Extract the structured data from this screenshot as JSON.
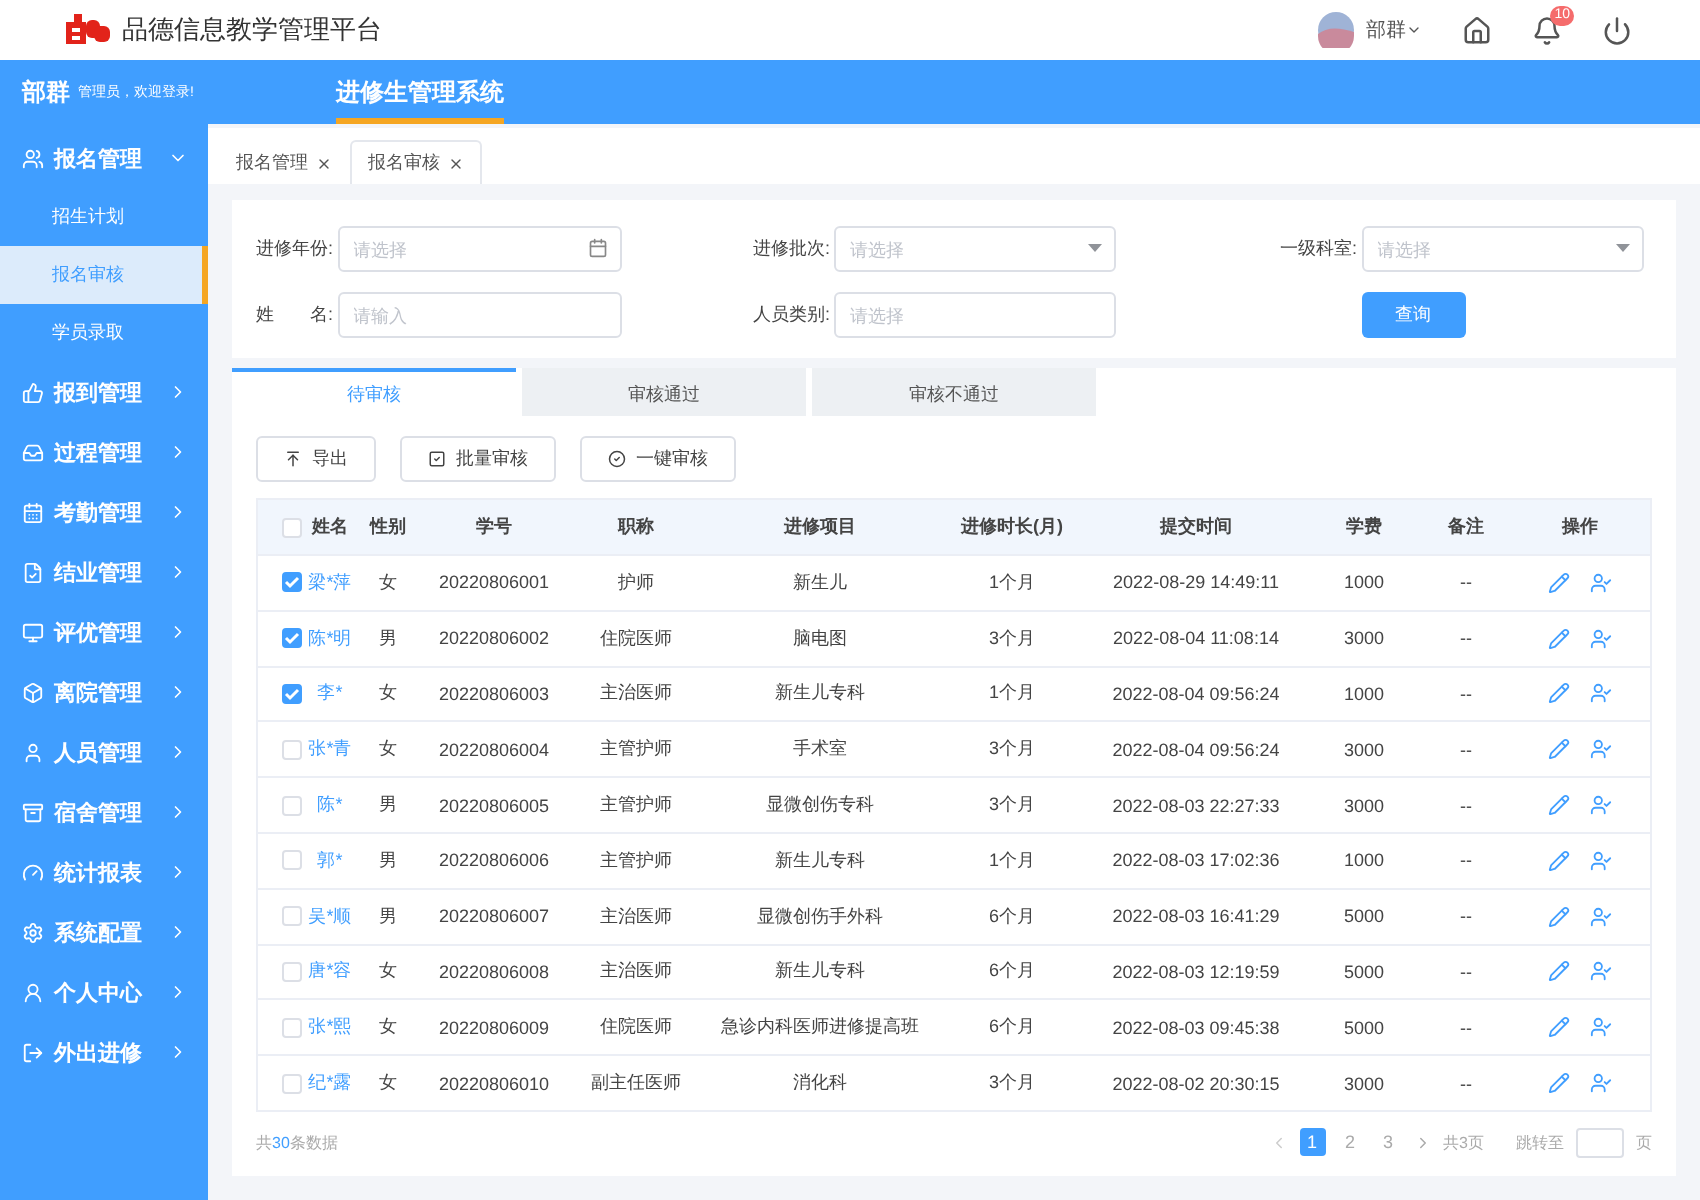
{
  "header": {
    "title": "品德信息教学管理平台",
    "user": "部群",
    "notification_count": "10"
  },
  "topbar": {
    "user_name": "部群",
    "greeting": "管理员，欢迎登录!",
    "nav": [
      {
        "label": "进修生管理系统",
        "selected": true
      }
    ]
  },
  "sidebar": {
    "items": [
      {
        "label": "报名管理",
        "expanded": true,
        "children": [
          {
            "label": "招生计划",
            "selected": false
          },
          {
            "label": "报名审核",
            "selected": true
          },
          {
            "label": "学员录取",
            "selected": false
          }
        ]
      },
      {
        "label": "报到管理",
        "expanded": false
      },
      {
        "label": "过程管理",
        "expanded": false
      },
      {
        "label": "考勤管理",
        "expanded": false
      },
      {
        "label": "结业管理",
        "expanded": false
      },
      {
        "label": "评优管理",
        "expanded": false
      },
      {
        "label": "离院管理",
        "expanded": false
      },
      {
        "label": "人员管理",
        "expanded": false
      },
      {
        "label": "宿舍管理",
        "expanded": false
      },
      {
        "label": "统计报表",
        "expanded": false
      },
      {
        "label": "系统配置",
        "expanded": false
      },
      {
        "label": "个人中心",
        "expanded": false
      },
      {
        "label": "外出进修",
        "expanded": false
      }
    ]
  },
  "page_tabs": [
    {
      "label": "报名管理",
      "selected": false
    },
    {
      "label": "报名审核",
      "selected": true
    }
  ],
  "filters": [
    {
      "label": "进修年份:",
      "kind": "date",
      "placeholder": "请选择"
    },
    {
      "label": "进修批次:",
      "kind": "select",
      "placeholder": "请选择"
    },
    {
      "label": "一级科室:",
      "kind": "select",
      "placeholder": "请选择"
    },
    {
      "label": "姓　　名:",
      "kind": "text",
      "placeholder": "请输入"
    },
    {
      "label": "人员类别:",
      "kind": "text",
      "placeholder": "请选择"
    }
  ],
  "query_button": "查询",
  "status_tabs": [
    {
      "label": "待审核",
      "selected": true
    },
    {
      "label": "审核通过",
      "selected": false
    },
    {
      "label": "审核不通过",
      "selected": false
    }
  ],
  "actions": [
    {
      "label": "导出"
    },
    {
      "label": "批量审核"
    },
    {
      "label": "一键审核"
    }
  ],
  "table": {
    "select_all": false,
    "columns": [
      "姓名",
      "性别",
      "学号",
      "职称",
      "进修项目",
      "进修时长(月)",
      "提交时间",
      "学费",
      "备注",
      "操作"
    ],
    "rows": [
      {
        "checked": true,
        "cells": [
          "梁*萍",
          "女",
          "20220806001",
          "护师",
          "新生儿",
          "1个月",
          "2022-08-29 14:49:11",
          "1000",
          "--"
        ]
      },
      {
        "checked": true,
        "cells": [
          "陈*明",
          "男",
          "20220806002",
          "住院医师",
          "脑电图",
          "3个月",
          "2022-08-04 11:08:14",
          "3000",
          "--"
        ]
      },
      {
        "checked": true,
        "cells": [
          "李*",
          "女",
          "20220806003",
          "主治医师",
          "新生儿专科",
          "1个月",
          "2022-08-04 09:56:24",
          "1000",
          "--"
        ]
      },
      {
        "checked": false,
        "cells": [
          "张*青",
          "女",
          "20220806004",
          "主管护师",
          "手术室",
          "3个月",
          "2022-08-04 09:56:24",
          "3000",
          "--"
        ]
      },
      {
        "checked": false,
        "cells": [
          "陈*",
          "男",
          "20220806005",
          "主管护师",
          "显微创伤专科",
          "3个月",
          "2022-08-03 22:27:33",
          "3000",
          "--"
        ]
      },
      {
        "checked": false,
        "cells": [
          "郭*",
          "男",
          "20220806006",
          "主管护师",
          "新生儿专科",
          "1个月",
          "2022-08-03 17:02:36",
          "1000",
          "--"
        ]
      },
      {
        "checked": false,
        "cells": [
          "吴*顺",
          "男",
          "20220806007",
          "主治医师",
          "显微创伤手外科",
          "6个月",
          "2022-08-03 16:41:29",
          "5000",
          "--"
        ]
      },
      {
        "checked": false,
        "cells": [
          "唐*容",
          "女",
          "20220806008",
          "主治医师",
          "新生儿专科",
          "6个月",
          "2022-08-03 12:19:59",
          "5000",
          "--"
        ]
      },
      {
        "checked": false,
        "cells": [
          "张*熙",
          "女",
          "20220806009",
          "住院医师",
          "急诊内科医师进修提高班",
          "6个月",
          "2022-08-03 09:45:38",
          "5000",
          "--"
        ]
      },
      {
        "checked": false,
        "cells": [
          "纪*露",
          "女",
          "20220806010",
          "副主任医师",
          "消化科",
          "3个月",
          "2022-08-02 20:30:15",
          "3000",
          "--"
        ]
      }
    ]
  },
  "footer": {
    "total": "共**30**条数据",
    "pages": [
      {
        "label": "1",
        "selected": true
      },
      {
        "label": "2",
        "selected": false
      },
      {
        "label": "3",
        "selected": false
      }
    ],
    "page_count": "共3页",
    "jump_label": "跳转至",
    "jump_suffix": "页"
  }
}
